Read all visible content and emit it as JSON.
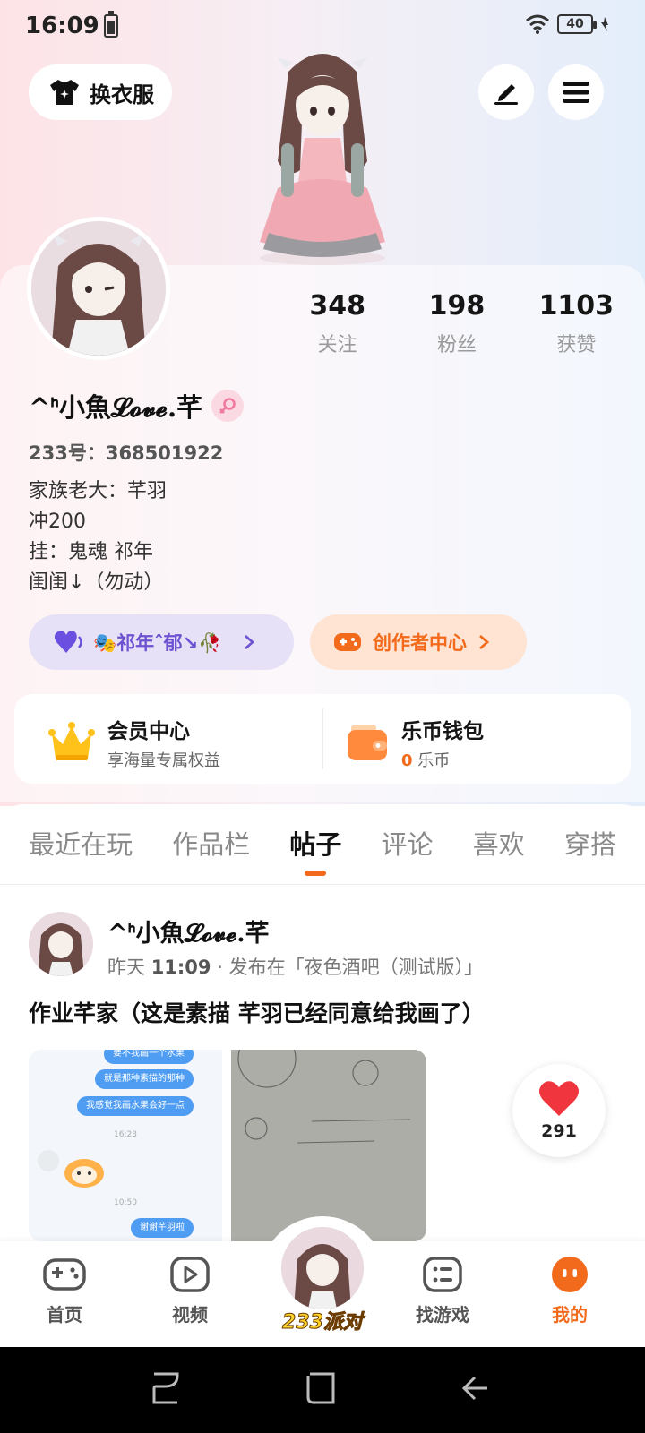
{
  "status_bar": {
    "time": "16:09",
    "battery": "40"
  },
  "top_bar": {
    "outfit_label": "换衣服"
  },
  "profile": {
    "stats": [
      {
        "value": "348",
        "label": "关注"
      },
      {
        "value": "198",
        "label": "粉丝"
      },
      {
        "value": "1103",
        "label": "获赞"
      }
    ],
    "nickname": "^ᑋ小魚𝓛𝓸𝓿𝓮.芊",
    "id_label": "233号：368501922",
    "bio_lines": [
      "家族老大：芊羽",
      "冲200",
      "挂：鬼魂 祁年",
      "闺闺↓（勿动）"
    ],
    "tag_pill": "🎭祁年ˆ郁↘🥀",
    "creator_center": "创作者中心"
  },
  "member_card": {
    "vip_title": "会员中心",
    "vip_subtitle": "享海量专属权益",
    "wallet_title": "乐币钱包",
    "wallet_amount": "0",
    "wallet_unit": "乐币"
  },
  "tabs": [
    "最近在玩",
    "作品栏",
    "帖子",
    "评论",
    "喜欢",
    "穿搭"
  ],
  "active_tab": "帖子",
  "post": {
    "author": "^ᑋ小魚𝓛𝓸𝓿𝓮.芊",
    "meta_day": "昨天",
    "meta_time": "11:09",
    "meta_location": "· 发布在「夜色酒吧（测试版）」",
    "text": "作业芊家（这是素描 芊羽已经同意给我画了）",
    "likes": "291",
    "chat": {
      "bubble_1": "要不我画一个水果",
      "bubble_2": "就是那种素描的那种",
      "bubble_3": "我感觉我画水果会好一点",
      "time_1": "16:23",
      "time_2": "10:50",
      "bubble_4": "谢谢芊羽啦"
    }
  },
  "bottom_nav": {
    "home": "首页",
    "video": "视频",
    "center": "233派对",
    "find_game": "找游戏",
    "mine": "我的"
  },
  "colors": {
    "accent": "#f26a1b",
    "purple": "#6d52d1",
    "heart": "#f0353f"
  }
}
